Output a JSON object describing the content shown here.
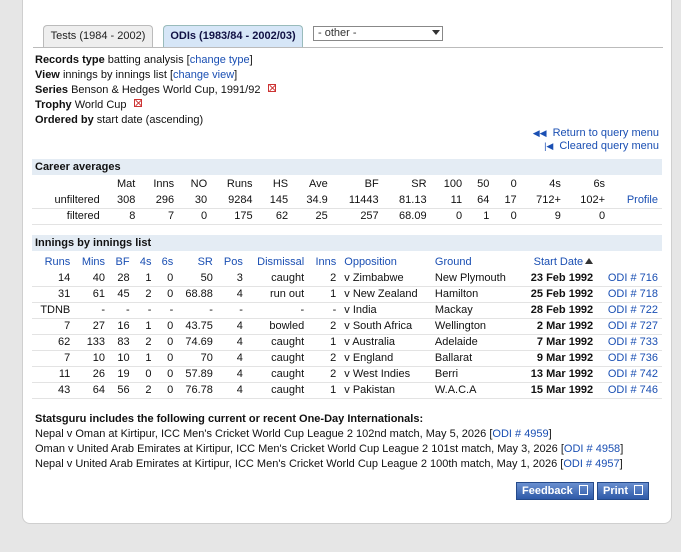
{
  "tabs": [
    {
      "label": "Tests (1984 - 2002)",
      "active": false
    },
    {
      "label": "ODIs (1983/84 - 2002/03)",
      "active": true
    }
  ],
  "other_select": {
    "value": "- other -"
  },
  "meta": {
    "records_type": {
      "label": "Records type",
      "value": "batting analysis",
      "link": "change type"
    },
    "view": {
      "label": "View",
      "value": "innings by innings list",
      "link": "change view"
    },
    "series": {
      "label": "Series",
      "value": "Benson & Hedges World Cup, 1991/92"
    },
    "trophy": {
      "label": "Trophy",
      "value": "World Cup"
    },
    "ordered_by": {
      "label": "Ordered by",
      "value": "start date (ascending)"
    }
  },
  "right_links": {
    "return": "Return to query menu",
    "cleared": "Cleared query menu"
  },
  "career": {
    "title": "Career averages",
    "headers": [
      "",
      "Mat",
      "Inns",
      "NO",
      "Runs",
      "HS",
      "Ave",
      "BF",
      "SR",
      "100",
      "50",
      "0",
      "4s",
      "6s",
      ""
    ],
    "rows": [
      [
        "unfiltered",
        "308",
        "296",
        "30",
        "9284",
        "145",
        "34.9",
        "11443",
        "81.13",
        "11",
        "64",
        "17",
        "712+",
        "102+",
        "Profile"
      ],
      [
        "filtered",
        "8",
        "7",
        "0",
        "175",
        "62",
        "25",
        "257",
        "68.09",
        "0",
        "1",
        "0",
        "9",
        "0",
        ""
      ]
    ]
  },
  "innings": {
    "title": "Innings by innings list",
    "headers": [
      "Runs",
      "Mins",
      "BF",
      "4s",
      "6s",
      "SR",
      "Pos",
      "Dismissal",
      "Inns",
      "Opposition",
      "Ground",
      "Start Date",
      ""
    ],
    "rows": [
      [
        "14",
        "40",
        "28",
        "1",
        "0",
        "50",
        "3",
        "caught",
        "2",
        "v Zimbabwe",
        "New Plymouth",
        "23 Feb 1992",
        "ODI # 716"
      ],
      [
        "31",
        "61",
        "45",
        "2",
        "0",
        "68.88",
        "4",
        "run out",
        "1",
        "v New Zealand",
        "Hamilton",
        "25 Feb 1992",
        "ODI # 718"
      ],
      [
        "TDNB",
        "-",
        "-",
        "-",
        "-",
        "-",
        "-",
        "-",
        "-",
        "v India",
        "Mackay",
        "28 Feb 1992",
        "ODI # 722"
      ],
      [
        "7",
        "27",
        "16",
        "1",
        "0",
        "43.75",
        "4",
        "bowled",
        "2",
        "v South Africa",
        "Wellington",
        "2 Mar 1992",
        "ODI # 727"
      ],
      [
        "62",
        "133",
        "83",
        "2",
        "0",
        "74.69",
        "4",
        "caught",
        "1",
        "v Australia",
        "Adelaide",
        "7 Mar 1992",
        "ODI # 733"
      ],
      [
        "7",
        "10",
        "10",
        "1",
        "0",
        "70",
        "4",
        "caught",
        "2",
        "v England",
        "Ballarat",
        "9 Mar 1992",
        "ODI # 736"
      ],
      [
        "11",
        "26",
        "19",
        "0",
        "0",
        "57.89",
        "4",
        "caught",
        "2",
        "v West Indies",
        "Berri",
        "13 Mar 1992",
        "ODI # 742"
      ],
      [
        "43",
        "64",
        "56",
        "2",
        "0",
        "76.78",
        "4",
        "caught",
        "1",
        "v Pakistan",
        "W.A.C.A",
        "15 Mar 1992",
        "ODI # 746"
      ]
    ]
  },
  "upcoming": {
    "heading": "Statsguru includes the following current or recent One-Day Internationals:",
    "items": [
      {
        "text": "Nepal v Oman at Kirtipur, ICC Men's Cricket World Cup League 2 102nd match, May 5, 2026",
        "link": "ODI # 4959"
      },
      {
        "text": "Oman v United Arab Emirates at Kirtipur, ICC Men's Cricket World Cup League 2 101st match, May 3, 2026",
        "link": "ODI # 4958"
      },
      {
        "text": "Nepal v United Arab Emirates at Kirtipur, ICC Men's Cricket World Cup League 2 100th match, May 1, 2026",
        "link": "ODI # 4957"
      }
    ]
  },
  "buttons": {
    "feedback": "Feedback",
    "print": "Print"
  }
}
